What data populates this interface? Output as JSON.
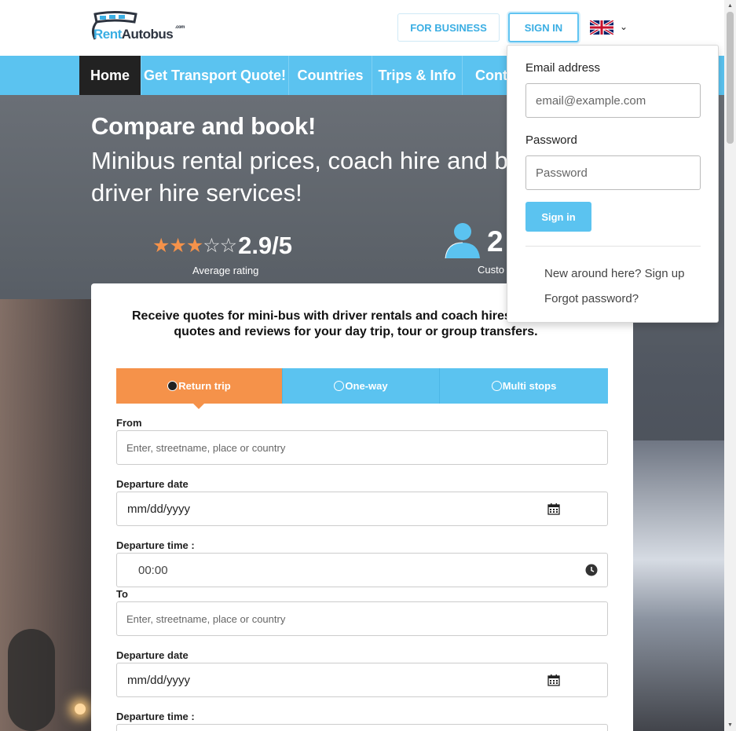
{
  "header": {
    "logo": {
      "rent": "Rent",
      "autobus": "Autobus",
      "tld": ".com"
    },
    "for_business": "FOR BUSINESS",
    "sign_in": "SIGN IN",
    "language_icon": "uk-flag-icon"
  },
  "nav": {
    "items": [
      {
        "label": "Home",
        "active": true
      },
      {
        "label": "Get Transport Quote!"
      },
      {
        "label": "Countries"
      },
      {
        "label": "Trips & Info"
      },
      {
        "label": "Conta"
      }
    ]
  },
  "hero": {
    "title": "Compare and book!",
    "subtitle_line1": "Minibus rental prices, coach hire and bu",
    "subtitle_line2": "driver hire services!",
    "rating_value": "2.9/5",
    "rating_stars": 2.9,
    "rating_label": "Average rating",
    "customers_value": "2",
    "customers_label": "Custo"
  },
  "form": {
    "intro_line1": "Receive quotes for mini-bus with driver rentals and coach hires.",
    "intro_line2": "quotes and reviews for your day trip, tour or group transfers.",
    "tabs": [
      {
        "label": "Return trip",
        "active": true
      },
      {
        "label": "One-way"
      },
      {
        "label": "Multi stops"
      }
    ],
    "from_label": "From",
    "from_placeholder": "Enter, streetname, place or country",
    "departure_date_label": "Departure date",
    "date_placeholder": "mm/dd/yyyy",
    "departure_time_label": "Departure time :",
    "time_value": "00:00",
    "to_label": "To",
    "to_placeholder": "Enter, streetname, place or country",
    "departure_date_label_2": "Departure date",
    "date_placeholder_2": "mm/dd/yyyy",
    "departure_time_label_2": "Departure time :"
  },
  "signin_dropdown": {
    "email_label": "Email address",
    "email_placeholder": "email@example.com",
    "password_label": "Password",
    "password_placeholder": "Password",
    "submit": "Sign in",
    "signup_link": "New around here? Sign up",
    "forgot_link": "Forgot password?"
  },
  "colors": {
    "accent_blue": "#5bc3f0",
    "accent_orange": "#f5924a",
    "nav_active": "#222222"
  }
}
